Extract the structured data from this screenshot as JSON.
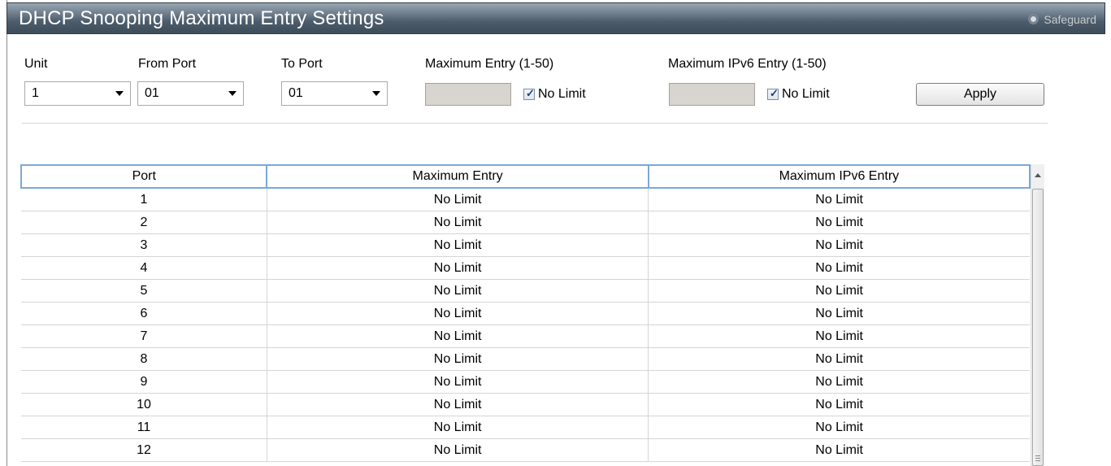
{
  "title": "DHCP Snooping Maximum Entry Settings",
  "safeguard_label": "Safeguard",
  "form": {
    "unit_label": "Unit",
    "unit_value": "1",
    "from_port_label": "From Port",
    "from_port_value": "01",
    "to_port_label": "To Port",
    "to_port_value": "01",
    "max_entry_label": "Maximum Entry (1-50)",
    "max_entry_value": "",
    "max_entry_nolimit_label": "No Limit",
    "max_entry_nolimit_checked": true,
    "max_ipv6_label": "Maximum IPv6 Entry (1-50)",
    "max_ipv6_value": "",
    "max_ipv6_nolimit_label": "No Limit",
    "max_ipv6_nolimit_checked": true,
    "apply_label": "Apply"
  },
  "table": {
    "headers": [
      "Port",
      "Maximum Entry",
      "Maximum IPv6 Entry"
    ],
    "rows": [
      [
        "1",
        "No Limit",
        "No Limit"
      ],
      [
        "2",
        "No Limit",
        "No Limit"
      ],
      [
        "3",
        "No Limit",
        "No Limit"
      ],
      [
        "4",
        "No Limit",
        "No Limit"
      ],
      [
        "5",
        "No Limit",
        "No Limit"
      ],
      [
        "6",
        "No Limit",
        "No Limit"
      ],
      [
        "7",
        "No Limit",
        "No Limit"
      ],
      [
        "8",
        "No Limit",
        "No Limit"
      ],
      [
        "9",
        "No Limit",
        "No Limit"
      ],
      [
        "10",
        "No Limit",
        "No Limit"
      ],
      [
        "11",
        "No Limit",
        "No Limit"
      ],
      [
        "12",
        "No Limit",
        "No Limit"
      ]
    ]
  },
  "colors": {
    "header_border": "#7aa9d6",
    "titlebar": "#4d5d6c"
  }
}
